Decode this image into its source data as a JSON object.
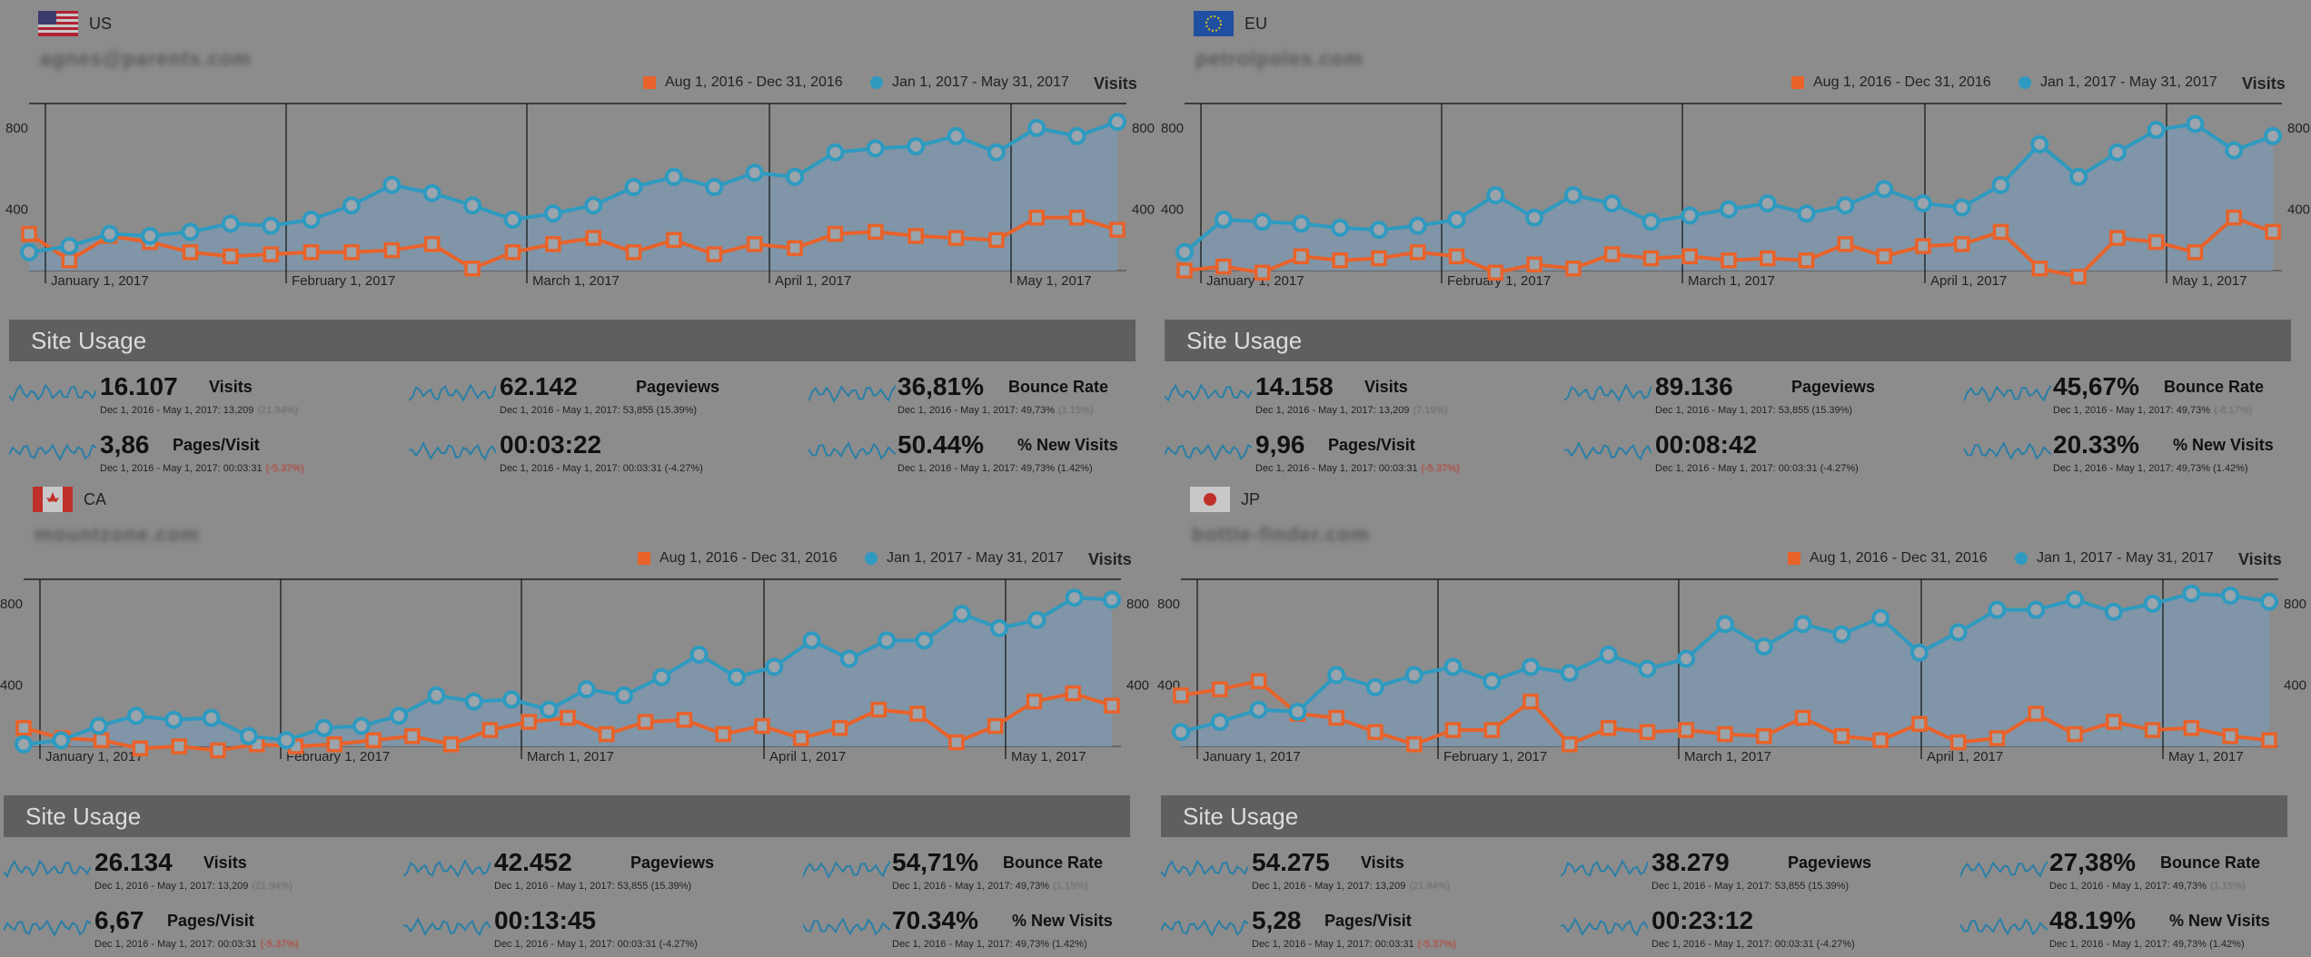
{
  "legend": {
    "range_a": "Aug 1, 2016 - Dec 31, 2016",
    "range_b": "Jan 1, 2017 - May 31, 2017",
    "metric": "Visits",
    "colors": {
      "range_a": "#e8622a",
      "range_b": "#2e9ac0",
      "area": "#7e97ab"
    }
  },
  "usage_title": "Site Usage",
  "panels": [
    {
      "region": "US",
      "flag": "us-flag-icon",
      "domain": "agnes@parents.com",
      "chart_data": {
        "type": "line",
        "x_ticks": [
          "January 1, 2017",
          "February 1, 2017",
          "March 1, 2017",
          "April 1, 2017",
          "May 1, 2017"
        ],
        "y_ticks": [
          400,
          800
        ],
        "ylim": [
          100,
          920
        ],
        "series": [
          {
            "name": "Jan 1, 2017 - May 31, 2017",
            "values": [
              190,
              220,
              280,
              270,
              290,
              330,
              320,
              350,
              420,
              520,
              480,
              420,
              350,
              380,
              420,
              510,
              560,
              510,
              580,
              560,
              680,
              700,
              710,
              760,
              680,
              800,
              760,
              830
            ]
          },
          {
            "name": "Aug 1, 2016 - Dec 31, 2016",
            "values": [
              280,
              150,
              270,
              240,
              190,
              170,
              180,
              190,
              190,
              200,
              230,
              110,
              190,
              230,
              260,
              190,
              250,
              180,
              230,
              210,
              280,
              290,
              270,
              260,
              250,
              360,
              360,
              300
            ]
          }
        ]
      },
      "metrics": [
        {
          "value": "16.107",
          "label": "Visits",
          "sub": "Dec 1, 2016 - May 1, 2017: 13,209",
          "change": "(21.94%)",
          "neg": false
        },
        {
          "value": "62.142",
          "label": "Pageviews",
          "sub": "Dec 1, 2016 - May 1, 2017: 53,855 (15.39%)",
          "change": "",
          "neg": false
        },
        {
          "value": "36,81%",
          "label": "Bounce Rate",
          "sub": "Dec 1, 2016 - May 1, 2017: 49,73%",
          "change": "(1.15%)",
          "neg": false
        },
        {
          "value": "3,86",
          "label": "Pages/Visit",
          "sub": "Dec 1, 2016 - May 1, 2017: 00:03:31",
          "change": "(-5.37%)",
          "neg": true
        },
        {
          "value": "00:03:22",
          "label": "",
          "sub": "Dec 1, 2016 - May 1, 2017: 00:03:31 (-4.27%)",
          "change": "",
          "neg": false
        },
        {
          "value": "50.44%",
          "label": "% New Visits",
          "sub": "Dec 1, 2016 - May 1, 2017: 49,73% (1.42%)",
          "change": "",
          "neg": false
        }
      ]
    },
    {
      "region": "EU",
      "flag": "eu-flag-icon",
      "domain": "petrolpoles.com",
      "chart_data": {
        "type": "line",
        "x_ticks": [
          "January 1, 2017",
          "February 1, 2017",
          "March 1, 2017",
          "April 1, 2017",
          "May 1, 2017"
        ],
        "y_ticks": [
          400,
          800
        ],
        "ylim": [
          100,
          920
        ],
        "series": [
          {
            "name": "Jan 1, 2017 - May 31, 2017",
            "values": [
              190,
              350,
              340,
              330,
              310,
              300,
              320,
              350,
              470,
              360,
              470,
              430,
              340,
              370,
              400,
              430,
              380,
              420,
              500,
              430,
              410,
              520,
              720,
              560,
              680,
              790,
              820,
              690,
              760
            ]
          },
          {
            "name": "Aug 1, 2016 - Dec 31, 2016",
            "values": [
              100,
              120,
              90,
              170,
              150,
              160,
              190,
              170,
              90,
              130,
              110,
              180,
              160,
              170,
              150,
              160,
              150,
              230,
              170,
              220,
              230,
              290,
              110,
              70,
              260,
              240,
              190,
              360,
              290
            ]
          }
        ]
      },
      "metrics": [
        {
          "value": "14.158",
          "label": "Visits",
          "sub": "Dec 1, 2016 - May 1, 2017: 13,209",
          "change": "(7.19%)",
          "neg": false
        },
        {
          "value": "89.136",
          "label": "Pageviews",
          "sub": "Dec 1, 2016 - May 1, 2017: 53,855 (15.39%)",
          "change": "",
          "neg": false
        },
        {
          "value": "45,67%",
          "label": "Bounce Rate",
          "sub": "Dec 1, 2016 - May 1, 2017: 49,73%",
          "change": "(-8.17%)",
          "neg": false
        },
        {
          "value": "9,96",
          "label": "Pages/Visit",
          "sub": "Dec 1, 2016 - May 1, 2017: 00:03:31",
          "change": "(-5.37%)",
          "neg": true
        },
        {
          "value": "00:08:42",
          "label": "",
          "sub": "Dec 1, 2016 - May 1, 2017: 00:03:31 (-4.27%)",
          "change": "",
          "neg": false
        },
        {
          "value": "20.33%",
          "label": "% New Visits",
          "sub": "Dec 1, 2016 - May 1, 2017: 49,73% (1.42%)",
          "change": "",
          "neg": false
        }
      ]
    },
    {
      "region": "CA",
      "flag": "ca-flag-icon",
      "domain": "mountzone.com",
      "chart_data": {
        "type": "line",
        "x_ticks": [
          "January 1, 2017",
          "February 1, 2017",
          "March 1, 2017",
          "April 1, 2017",
          "May 1, 2017"
        ],
        "y_ticks": [
          400,
          800
        ],
        "ylim": [
          100,
          920
        ],
        "series": [
          {
            "name": "Jan 1, 2017 - May 31, 2017",
            "values": [
              110,
              130,
              200,
              250,
              230,
              240,
              150,
              130,
              190,
              200,
              250,
              350,
              320,
              330,
              280,
              380,
              350,
              440,
              550,
              440,
              490,
              620,
              530,
              620,
              620,
              750,
              680,
              720,
              830,
              820
            ]
          },
          {
            "name": "Aug 1, 2016 - Dec 31, 2016",
            "values": [
              190,
              140,
              130,
              90,
              100,
              80,
              110,
              100,
              110,
              130,
              150,
              110,
              180,
              220,
              240,
              160,
              220,
              230,
              160,
              200,
              140,
              190,
              280,
              260,
              120,
              200,
              320,
              360,
              300
            ]
          }
        ]
      },
      "metrics": [
        {
          "value": "26.134",
          "label": "Visits",
          "sub": "Dec 1, 2016 - May 1, 2017: 13,209",
          "change": "(21.94%)",
          "neg": false
        },
        {
          "value": "42.452",
          "label": "Pageviews",
          "sub": "Dec 1, 2016 - May 1, 2017: 53,855 (15.39%)",
          "change": "",
          "neg": false
        },
        {
          "value": "54,71%",
          "label": "Bounce Rate",
          "sub": "Dec 1, 2016 - May 1, 2017: 49,73%",
          "change": "(1.15%)",
          "neg": false
        },
        {
          "value": "6,67",
          "label": "Pages/Visit",
          "sub": "Dec 1, 2016 - May 1, 2017: 00:03:31",
          "change": "(-5.37%)",
          "neg": true
        },
        {
          "value": "00:13:45",
          "label": "",
          "sub": "Dec 1, 2016 - May 1, 2017: 00:03:31 (-4.27%)",
          "change": "",
          "neg": false
        },
        {
          "value": "70.34%",
          "label": "% New Visits",
          "sub": "Dec 1, 2016 - May 1, 2017: 49,73% (1.42%)",
          "change": "",
          "neg": false
        }
      ]
    },
    {
      "region": "JP",
      "flag": "jp-flag-icon",
      "domain": "bottle-finder.com",
      "chart_data": {
        "type": "line",
        "x_ticks": [
          "January 1, 2017",
          "February 1, 2017",
          "March 1, 2017",
          "April 1, 2017",
          "May 1, 2017"
        ],
        "y_ticks": [
          400,
          800
        ],
        "ylim": [
          100,
          920
        ],
        "series": [
          {
            "name": "Jan 1, 2017 - May 31, 2017",
            "values": [
              170,
              220,
              280,
              270,
              450,
              390,
              450,
              490,
              420,
              490,
              460,
              550,
              480,
              530,
              700,
              590,
              700,
              650,
              730,
              560,
              660,
              770,
              770,
              820,
              760,
              800,
              850,
              840,
              810
            ]
          },
          {
            "name": "Aug 1, 2016 - Dec 31, 2016",
            "values": [
              350,
              380,
              420,
              260,
              240,
              170,
              110,
              180,
              180,
              320,
              110,
              190,
              170,
              180,
              160,
              150,
              240,
              150,
              130,
              210,
              120,
              140,
              260,
              160,
              220,
              180,
              190,
              150,
              130
            ]
          }
        ]
      },
      "metrics": [
        {
          "value": "54.275",
          "label": "Visits",
          "sub": "Dec 1, 2016 - May 1, 2017: 13,209",
          "change": "(21.94%)",
          "neg": false
        },
        {
          "value": "38.279",
          "label": "Pageviews",
          "sub": "Dec 1, 2016 - May 1, 2017: 53,855 (15.39%)",
          "change": "",
          "neg": false
        },
        {
          "value": "27,38%",
          "label": "Bounce Rate",
          "sub": "Dec 1, 2016 - May 1, 2017: 49,73%",
          "change": "(1.15%)",
          "neg": false
        },
        {
          "value": "5,28",
          "label": "Pages/Visit",
          "sub": "Dec 1, 2016 - May 1, 2017: 00:03:31",
          "change": "(-5.37%)",
          "neg": true
        },
        {
          "value": "00:23:12",
          "label": "",
          "sub": "Dec 1, 2016 - May 1, 2017: 00:03:31 (-4.27%)",
          "change": "",
          "neg": false
        },
        {
          "value": "48.19%",
          "label": "% New Visits",
          "sub": "Dec 1, 2016 - May 1, 2017: 49,73% (1.42%)",
          "change": "",
          "neg": false
        }
      ]
    }
  ]
}
